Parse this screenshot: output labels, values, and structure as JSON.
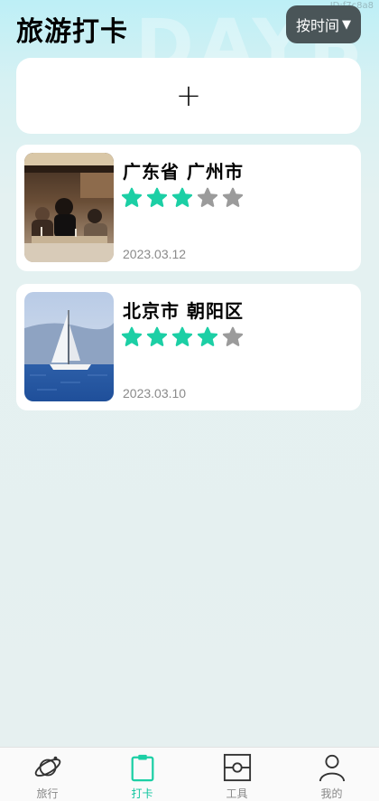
{
  "header": {
    "title": "旅游打卡",
    "watermark": "DAYB",
    "corner_id": "ID:f7c8a8",
    "sort_label": "按时间",
    "sort_caret": "▼"
  },
  "add_card": {
    "symbol": "+"
  },
  "records": [
    {
      "location": "广东省 广州市",
      "rating": 3,
      "max_rating": 5,
      "date": "2023.03.12",
      "photo_icon": "restaurant-photo"
    },
    {
      "location": "北京市 朝阳区",
      "rating": 4,
      "max_rating": 5,
      "date": "2023.03.10",
      "photo_icon": "sailboat-photo"
    }
  ],
  "colors": {
    "accent": "#1ccfa5",
    "star_off": "#9b9b9b",
    "sort_bg": "#4a5558"
  },
  "tabbar": {
    "items": [
      {
        "label": "旅行",
        "icon": "planet-icon",
        "active": false
      },
      {
        "label": "打卡",
        "icon": "clipboard-icon",
        "active": true
      },
      {
        "label": "工具",
        "icon": "tool-box-icon",
        "active": false
      },
      {
        "label": "我的",
        "icon": "person-icon",
        "active": false
      }
    ]
  }
}
